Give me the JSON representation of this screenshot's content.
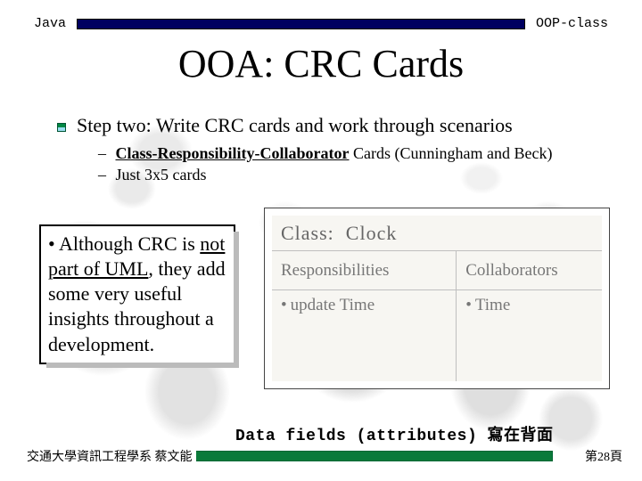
{
  "header": {
    "left": "Java",
    "right": "OOP-class"
  },
  "title": "OOA: CRC Cards",
  "bullets": {
    "step": "Step two: Write CRC cards and work through scenarios",
    "sub1_bold": "Class-Responsibility-Collaborator",
    "sub1_rest": " Cards (Cunningham and Beck)",
    "sub2": "Just 3x5 cards"
  },
  "note": {
    "lead": "• Although CRC is ",
    "not_part": "not part of UML",
    "rest": ", they add some very useful insights throughout a development."
  },
  "crc": {
    "class_label": "Class:",
    "class_value": "Clock",
    "responsibilities": "Responsibilities",
    "collaborators": "Collaborators",
    "resp_item": "update Time",
    "collab_item": "Time"
  },
  "footer": {
    "attributes_note": "Data fields (attributes) 寫在背面",
    "author": "交通大學資訊工程學系 蔡文能",
    "page": "第28頁"
  }
}
